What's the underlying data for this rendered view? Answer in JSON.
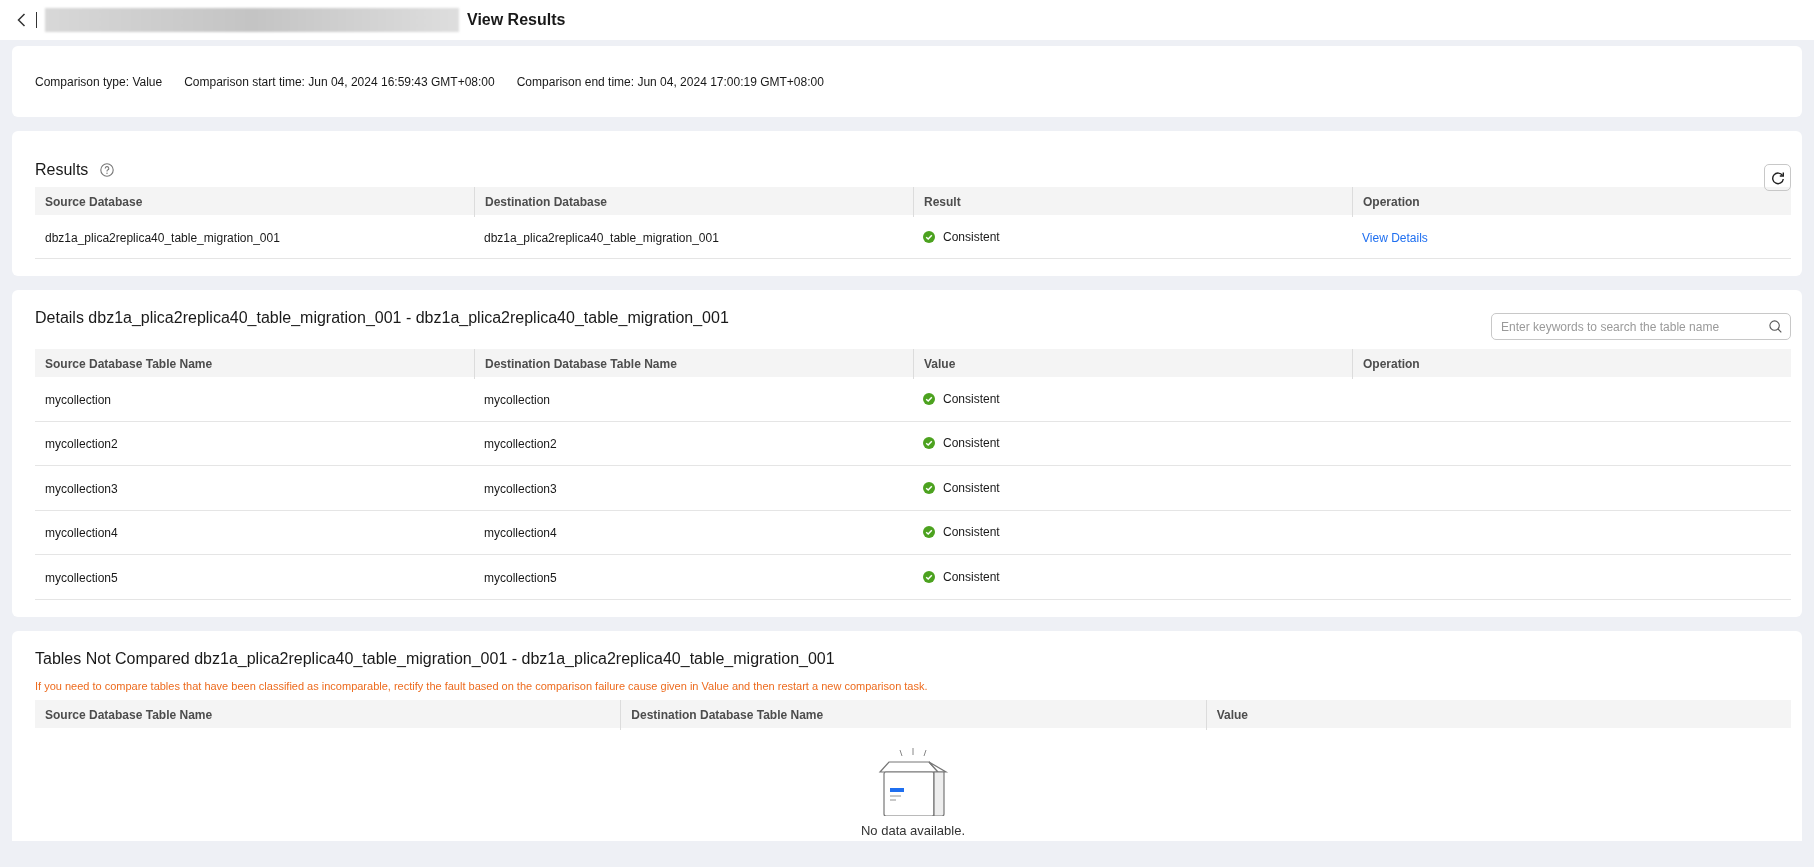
{
  "header": {
    "title": "View Results"
  },
  "summary": [
    "Comparison type: Value",
    "Comparison start time: Jun 04, 2024 16:59:43 GMT+08:00",
    "Comparison end time: Jun 04, 2024 17:00:19 GMT+08:00"
  ],
  "results": {
    "title": "Results",
    "columns": [
      "Source Database",
      "Destination Database",
      "Result",
      "Operation"
    ],
    "rows": [
      {
        "source": "dbz1a_plica2replica40_table_migration_001",
        "destination": "dbz1a_plica2replica40_table_migration_001",
        "result": {
          "text": "Consistent",
          "kind": "success"
        },
        "operation": "View Details"
      }
    ]
  },
  "details": {
    "title": "Details dbz1a_plica2replica40_table_migration_001 - dbz1a_plica2replica40_table_migration_001",
    "search": {
      "placeholder": "Enter keywords to search the table name"
    },
    "columns": [
      "Source Database Table Name",
      "Destination Database Table Name",
      "Value",
      "Operation"
    ],
    "rows": [
      {
        "source": "mycollection",
        "destination": "mycollection",
        "value": {
          "text": "Consistent",
          "kind": "success"
        }
      },
      {
        "source": "mycollection2",
        "destination": "mycollection2",
        "value": {
          "text": "Consistent",
          "kind": "success"
        }
      },
      {
        "source": "mycollection3",
        "destination": "mycollection3",
        "value": {
          "text": "Consistent",
          "kind": "success"
        }
      },
      {
        "source": "mycollection4",
        "destination": "mycollection4",
        "value": {
          "text": "Consistent",
          "kind": "success"
        }
      },
      {
        "source": "mycollection5",
        "destination": "mycollection5",
        "value": {
          "text": "Consistent",
          "kind": "success"
        }
      }
    ]
  },
  "not_compared": {
    "title": "Tables Not Compared dbz1a_plica2replica40_table_migration_001 - dbz1a_plica2replica40_table_migration_001",
    "note": "If you need to compare tables that have been classified as incomparable, rectify the fault based on the comparison failure cause given in Value and then restart a new comparison task.",
    "columns": [
      "Source Database Table Name",
      "Destination Database Table Name",
      "Value"
    ],
    "empty_text": "No data available."
  }
}
